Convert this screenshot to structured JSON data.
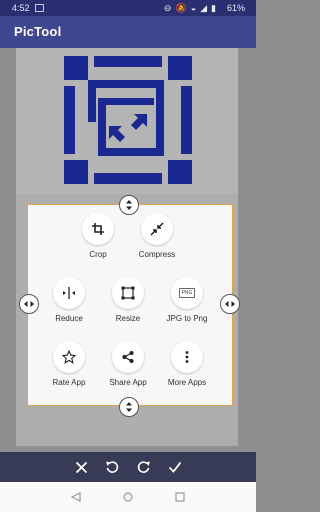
{
  "status_bar": {
    "time": "4:52",
    "battery": "61%",
    "icons": [
      "do-not-disturb-icon",
      "notification-muted-icon",
      "wifi-icon",
      "signal-icon",
      "battery-icon"
    ]
  },
  "app_bar": {
    "title": "PicTool"
  },
  "tools": [
    {
      "label": "Crop",
      "icon": "crop-icon"
    },
    {
      "label": "Compress",
      "icon": "compress-icon"
    },
    {
      "label": "Reduce",
      "icon": "reduce-icon"
    },
    {
      "label": "Resize",
      "icon": "resize-icon"
    },
    {
      "label": "JPG to Png",
      "icon": "png-icon",
      "icon_text": "PNG"
    },
    {
      "label": "Rate App",
      "icon": "star-icon"
    },
    {
      "label": "Share App",
      "icon": "share-icon"
    },
    {
      "label": "More Apps",
      "icon": "more-vertical-icon"
    }
  ],
  "bottom_actions": [
    "close-icon",
    "rotate-left-icon",
    "rotate-right-icon",
    "check-icon"
  ],
  "nav_bar": [
    "back-icon",
    "home-icon",
    "recents-icon"
  ],
  "colors": {
    "app_bar": "#3f4790",
    "status_bar": "#2a2f72",
    "logo_blue": "#1b2891",
    "crop_border": "#e4a24a",
    "bottom_bar": "#373b56"
  }
}
